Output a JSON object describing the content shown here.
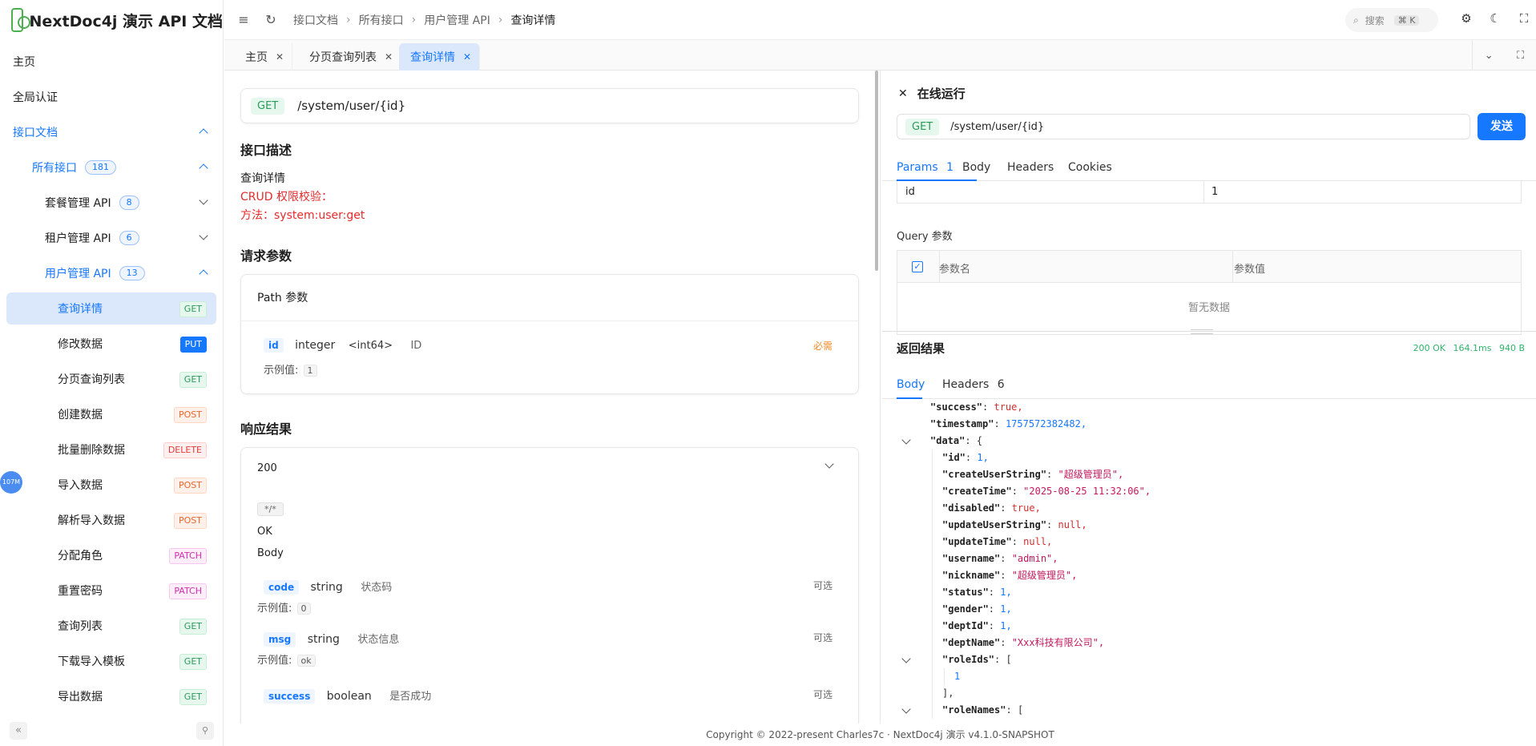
{
  "app": {
    "title": "NextDoc4j 演示 API 文档",
    "float_badge": "107M"
  },
  "sidebar": {
    "items": [
      {
        "label": "主页"
      },
      {
        "label": "全局认证"
      },
      {
        "label": "接口文档"
      },
      {
        "label": "所有接口",
        "count": "181"
      },
      {
        "label": "套餐管理 API",
        "count": "8"
      },
      {
        "label": "租户管理 API",
        "count": "6"
      },
      {
        "label": "用户管理 API",
        "count": "13"
      },
      {
        "label": "查询详情",
        "method": "GET"
      },
      {
        "label": "修改数据",
        "method": "PUT"
      },
      {
        "label": "分页查询列表",
        "method": "GET"
      },
      {
        "label": "创建数据",
        "method": "POST"
      },
      {
        "label": "批量删除数据",
        "method": "DELETE"
      },
      {
        "label": "导入数据",
        "method": "POST"
      },
      {
        "label": "解析导入数据",
        "method": "POST"
      },
      {
        "label": "分配角色",
        "method": "PATCH"
      },
      {
        "label": "重置密码",
        "method": "PATCH"
      },
      {
        "label": "查询列表",
        "method": "GET"
      },
      {
        "label": "下载导入模板",
        "method": "GET"
      },
      {
        "label": "导出数据",
        "method": "GET"
      }
    ]
  },
  "header": {
    "breadcrumb": [
      "接口文档",
      "所有接口",
      "用户管理 API",
      "查询详情"
    ],
    "search_placeholder": "搜索",
    "search_shortcut": "⌘ K"
  },
  "tabs": [
    {
      "label": "主页"
    },
    {
      "label": "分页查询列表"
    },
    {
      "label": "查询详情"
    }
  ],
  "doc": {
    "method": "GET",
    "path": "/system/user/{id}",
    "desc_title": "接口描述",
    "desc_lines": [
      "查询详情",
      "CRUD 权限校验：",
      "方法：system:user:get"
    ],
    "params_title": "请求参数",
    "path_params_title": "Path 参数",
    "path_param": {
      "name": "id",
      "type": "integer",
      "format": "<int64>",
      "desc": "ID",
      "required": "必需",
      "example_label": "示例值:",
      "example": "1"
    },
    "response_title": "响应结果",
    "response_code": "200",
    "content_type": "*/*",
    "response_desc": "OK",
    "body_label": "Body",
    "fields": [
      {
        "name": "code",
        "type": "string",
        "desc": "状态码",
        "optional": "可选",
        "example_label": "示例值:",
        "example": "0"
      },
      {
        "name": "msg",
        "type": "string",
        "desc": "状态信息",
        "optional": "可选",
        "example_label": "示例值:",
        "example": "ok"
      },
      {
        "name": "success",
        "type": "boolean",
        "desc": "是否成功",
        "optional": "可选"
      }
    ]
  },
  "run": {
    "title": "在线运行",
    "method": "GET",
    "url": "/system/user/{id}",
    "send_label": "发送",
    "tabs": [
      {
        "label": "Params",
        "count": "1"
      },
      {
        "label": "Body"
      },
      {
        "label": "Headers"
      },
      {
        "label": "Cookies"
      }
    ],
    "path_row": {
      "key": "id",
      "value": "1"
    },
    "query_label": "Query 参数",
    "query_col_name": "参数名",
    "query_col_value": "参数值",
    "query_empty": "暂无数据",
    "result_title": "返回结果",
    "result_status": "200 OK",
    "result_time": "164.1ms",
    "result_size": "940 B",
    "result_tabs": [
      {
        "label": "Body"
      },
      {
        "label": "Headers",
        "count": "6"
      }
    ]
  },
  "response_json": [
    {
      "indent": 1,
      "key": "\"success\"",
      "value": "true,",
      "vtype": "jb",
      "partial": true
    },
    {
      "indent": 1,
      "key": "\"timestamp\"",
      "value": "1757572382482,",
      "vtype": "jn"
    },
    {
      "indent": 1,
      "key": "\"data\"",
      "value": "{",
      "vtype": "jp",
      "fold": true
    },
    {
      "indent": 2,
      "key": "\"id\"",
      "value": "1,",
      "vtype": "jn"
    },
    {
      "indent": 2,
      "key": "\"createUserString\"",
      "value": "\"超级管理员\",",
      "vtype": "js"
    },
    {
      "indent": 2,
      "key": "\"createTime\"",
      "value": "\"2025-08-25 11:32:06\",",
      "vtype": "js"
    },
    {
      "indent": 2,
      "key": "\"disabled\"",
      "value": "true,",
      "vtype": "jb"
    },
    {
      "indent": 2,
      "key": "\"updateUserString\"",
      "value": "null,",
      "vtype": "jb"
    },
    {
      "indent": 2,
      "key": "\"updateTime\"",
      "value": "null,",
      "vtype": "jb"
    },
    {
      "indent": 2,
      "key": "\"username\"",
      "value": "\"admin\",",
      "vtype": "js"
    },
    {
      "indent": 2,
      "key": "\"nickname\"",
      "value": "\"超级管理员\",",
      "vtype": "js"
    },
    {
      "indent": 2,
      "key": "\"status\"",
      "value": "1,",
      "vtype": "jn"
    },
    {
      "indent": 2,
      "key": "\"gender\"",
      "value": "1,",
      "vtype": "jn"
    },
    {
      "indent": 2,
      "key": "\"deptId\"",
      "value": "1,",
      "vtype": "jn"
    },
    {
      "indent": 2,
      "key": "\"deptName\"",
      "value": "\"Xxx科技有限公司\",",
      "vtype": "js"
    },
    {
      "indent": 2,
      "key": "\"roleIds\"",
      "value": "[",
      "vtype": "jp",
      "fold": true
    },
    {
      "indent": 3,
      "key": "",
      "value": "1",
      "vtype": "jn"
    },
    {
      "indent": 2,
      "key": "",
      "value": "],",
      "vtype": "jp"
    },
    {
      "indent": 2,
      "key": "\"roleNames\"",
      "value": "[",
      "vtype": "jp",
      "fold": true
    }
  ],
  "footer": {
    "text": "Copyright © 2022-present Charles7c · NextDoc4j 演示 v4.1.0-SNAPSHOT"
  }
}
